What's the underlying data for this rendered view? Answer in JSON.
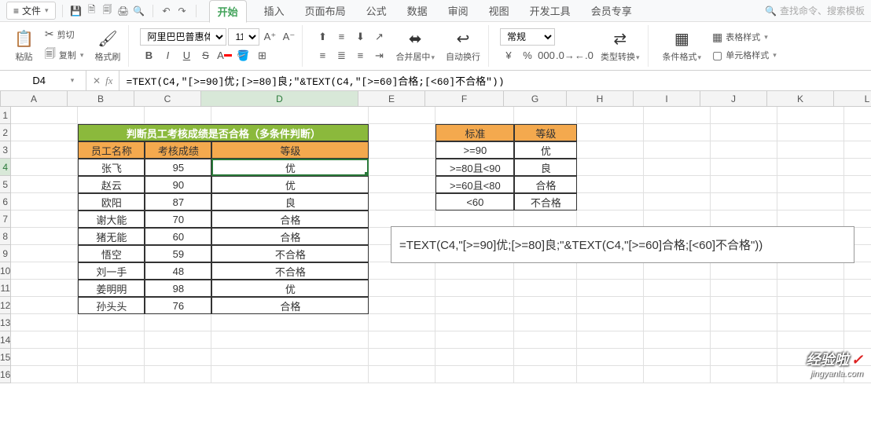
{
  "menubar": {
    "file_label": "文件",
    "search_placeholder": "查找命令、搜索模板"
  },
  "tabs": [
    "开始",
    "插入",
    "页面布局",
    "公式",
    "数据",
    "审阅",
    "视图",
    "开发工具",
    "会员专享"
  ],
  "active_tab": 0,
  "ribbon": {
    "paste": "粘贴",
    "cut": "剪切",
    "copy": "复制",
    "format_painter": "格式刷",
    "font_name": "阿里巴巴普惠体",
    "font_size": "11",
    "merge_center": "合并居中",
    "wrap_text": "自动换行",
    "number_format": "常规",
    "type_convert": "类型转换",
    "cond_format": "条件格式",
    "table_style": "表格样式",
    "cell_style": "单元格样式"
  },
  "name_box": "D4",
  "formula": "=TEXT(C4,\"[>=90]优;[>=80]良;\"&TEXT(C4,\"[>=60]合格;[<60]不合格\"))",
  "annotation_text": "=TEXT(C4,\"[>=90]优;[>=80]良;\"&TEXT(C4,\"[>=60]合格;[<60]不合格\"))",
  "columns": [
    "A",
    "B",
    "C",
    "D",
    "E",
    "F",
    "G",
    "H",
    "I",
    "J",
    "K",
    "L"
  ],
  "row_count": 16,
  "main_table": {
    "title": "判断员工考核成绩是否合格（多条件判断）",
    "headers": [
      "员工名称",
      "考核成绩",
      "等级"
    ],
    "rows": [
      {
        "name": "张飞",
        "score": "95",
        "grade": "优"
      },
      {
        "name": "赵云",
        "score": "90",
        "grade": "优"
      },
      {
        "name": "欧阳",
        "score": "87",
        "grade": "良"
      },
      {
        "name": "谢大能",
        "score": "70",
        "grade": "合格"
      },
      {
        "name": "猪无能",
        "score": "60",
        "grade": "合格"
      },
      {
        "name": "悟空",
        "score": "59",
        "grade": "不合格"
      },
      {
        "name": "刘一手",
        "score": "48",
        "grade": "不合格"
      },
      {
        "name": "姜明明",
        "score": "98",
        "grade": "优"
      },
      {
        "name": "孙头头",
        "score": "76",
        "grade": "合格"
      }
    ]
  },
  "criteria_table": {
    "headers": [
      "标准",
      "等级"
    ],
    "rows": [
      {
        "std": ">=90",
        "grade": "优"
      },
      {
        "std": ">=80且<90",
        "grade": "良"
      },
      {
        "std": ">=60且<80",
        "grade": "合格"
      },
      {
        "std": "<60",
        "grade": "不合格"
      }
    ]
  },
  "watermark": {
    "line1": "经验啦",
    "line2": "jingyanla.com"
  }
}
